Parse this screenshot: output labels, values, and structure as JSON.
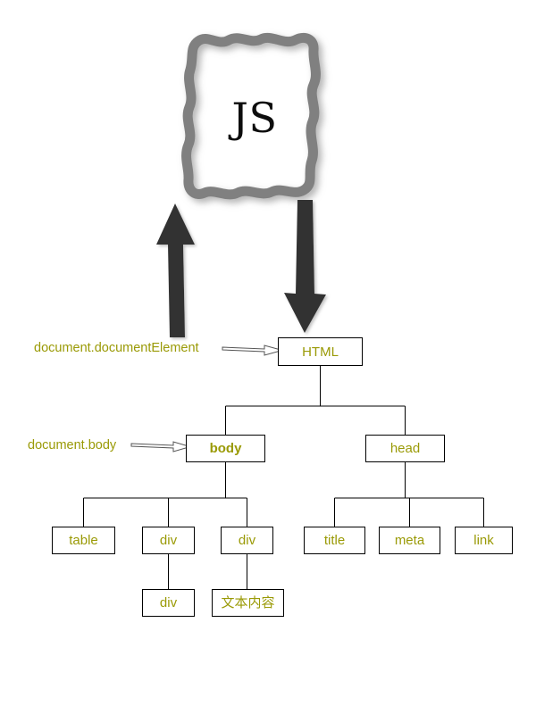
{
  "diagram": {
    "title": "JS",
    "colors": {
      "node_text": "#9a9a06",
      "node_border": "#000000",
      "background": "#ffffff",
      "arrow_thick": "#333333",
      "js_border": "#808080",
      "js_text": "#0d0d0d",
      "connector": "#000000"
    },
    "js_node": {
      "label": "JS",
      "shape": "wavy-rounded-rectangle"
    },
    "thick_arrows": [
      {
        "name": "arrow-html-to-js",
        "direction": "up",
        "from": "HTML",
        "to": "JS",
        "color": "#333333"
      },
      {
        "name": "arrow-js-to-html",
        "direction": "down",
        "from": "JS",
        "to": "HTML",
        "color": "#333333"
      }
    ],
    "annotations": [
      {
        "name": "annotation-document-documentelement",
        "text": "document.documentElement",
        "points_to": "HTML"
      },
      {
        "name": "annotation-document-body",
        "text": "document.body",
        "points_to": "body"
      }
    ],
    "tree": {
      "root": {
        "id": "html",
        "label": "HTML",
        "bold": false,
        "children": [
          {
            "id": "body",
            "label": "body",
            "bold": true,
            "children": [
              {
                "id": "table",
                "label": "table",
                "bold": false,
                "children": []
              },
              {
                "id": "div1",
                "label": "div",
                "bold": false,
                "children": [
                  {
                    "id": "div1-1",
                    "label": "div",
                    "bold": false,
                    "children": []
                  }
                ]
              },
              {
                "id": "div2",
                "label": "div",
                "bold": false,
                "children": [
                  {
                    "id": "textnode",
                    "label": "文本内容",
                    "bold": false,
                    "cjk": true,
                    "children": []
                  }
                ]
              }
            ]
          },
          {
            "id": "head",
            "label": "head",
            "bold": false,
            "children": [
              {
                "id": "title",
                "label": "title",
                "bold": false,
                "children": []
              },
              {
                "id": "meta",
                "label": "meta",
                "bold": false,
                "children": []
              },
              {
                "id": "link",
                "label": "link",
                "bold": false,
                "children": []
              }
            ]
          }
        ]
      }
    }
  }
}
